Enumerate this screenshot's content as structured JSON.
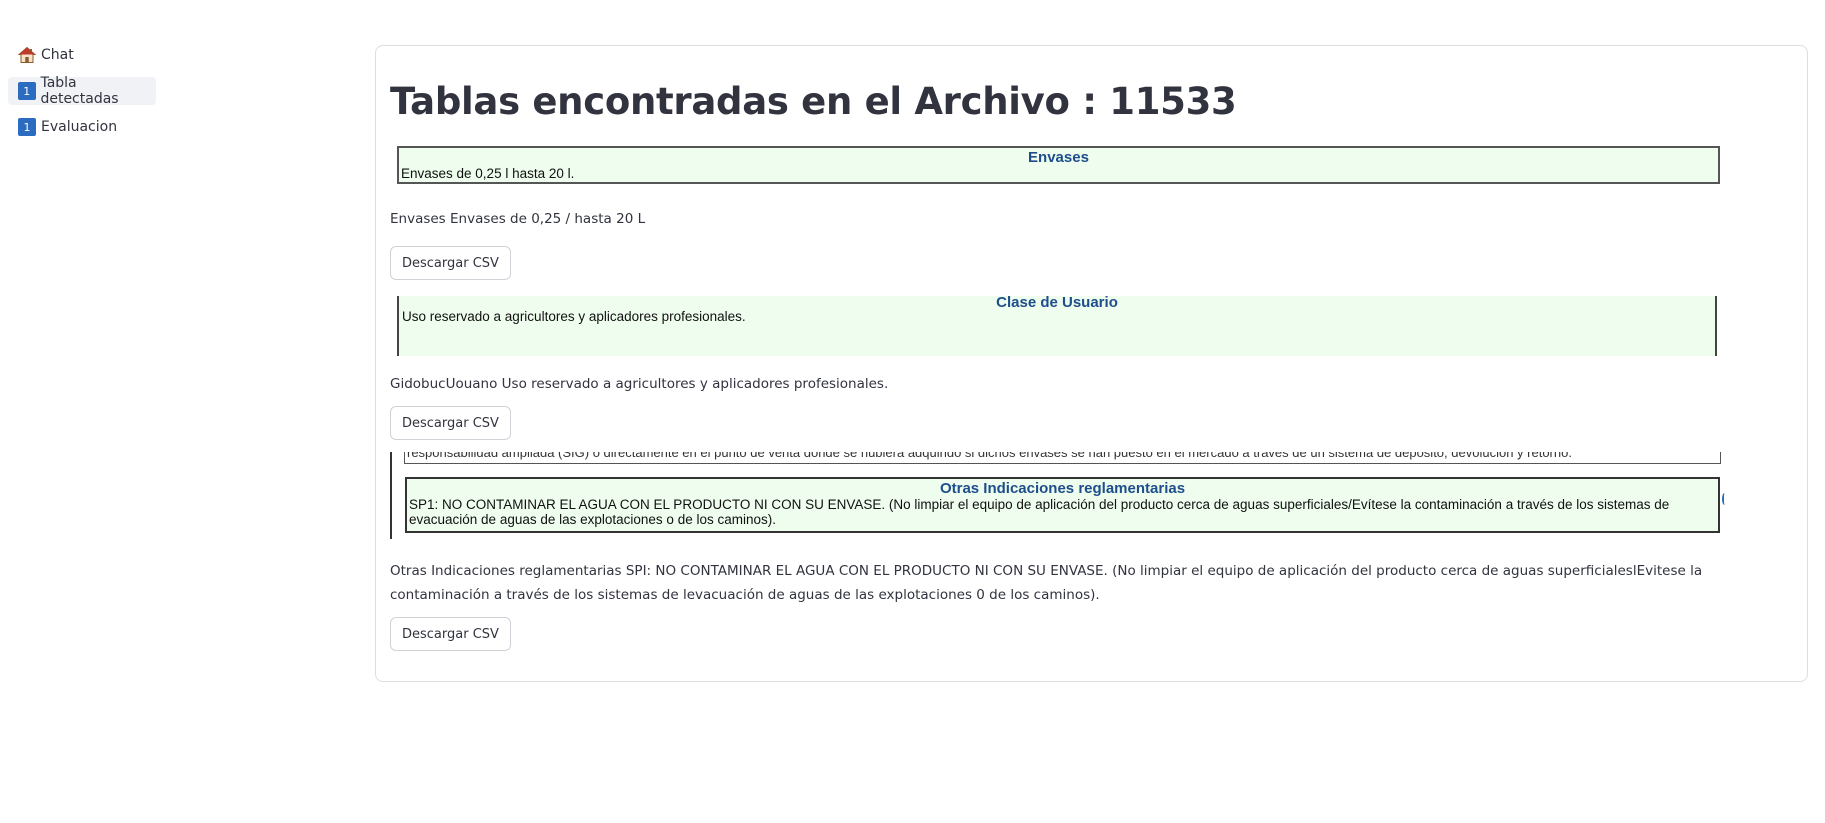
{
  "sidebar": {
    "items": [
      {
        "label": "Chat",
        "icon": "house-icon",
        "active": false
      },
      {
        "label": "Tabla detectadas",
        "icon": "keycap-one-icon",
        "icon_text": "1",
        "active": true
      },
      {
        "label": "Evaluacion",
        "icon": "keycap-one-icon",
        "icon_text": "1",
        "active": false
      }
    ]
  },
  "main": {
    "title": "Tablas encontradas en el Archivo : 11533",
    "tables": [
      {
        "image_header": "Envases",
        "image_text": "Envases de 0,25 l hasta 20 l.",
        "extracted_text": "Envases Envases de 0,25 / hasta 20 L",
        "button_label": "Descargar CSV"
      },
      {
        "image_header": "Clase de Usuario",
        "image_text": "Uso reservado a agricultores y aplicadores profesionales.",
        "extracted_text": "GidobucUouano Uso reservado a agricultores y aplicadores profesionales.",
        "button_label": "Descargar CSV"
      },
      {
        "image_top_text": "responsabilidad ampliada (SIG) o directamente en el punto de venta donde se hubiera adquirido si dichos envases se han puesto en el mercado a través de un sistema de depósito, devolución y retorno.",
        "image_header": "Otras Indicaciones reglamentarias",
        "image_text": "SP1: NO CONTAMINAR EL AGUA CON EL PRODUCTO NI CON SU ENVASE. (No limpiar el equipo de aplicación del producto cerca de aguas superficiales/Evítese la contaminación a través de los sistemas de evacuación de aguas de las explotaciones o de los caminos).",
        "extracted_text": "Otras Indicaciones reglamentarias SPI: NO CONTAMINAR EL AGUA CON EL PRODUCTO NI CON SU ENVASE. (No limpiar el equipo de aplicación del producto cerca de aguas superficialeslEvitese la contaminación a través de los sistemas de levacuación de aguas de las explotaciones 0 de los caminos).",
        "button_label": "Descargar CSV"
      }
    ]
  },
  "colors": {
    "accent_blue": "#2b6bc0",
    "snapshot_background": "#eefdee",
    "snapshot_header": "#1f4e8c"
  }
}
